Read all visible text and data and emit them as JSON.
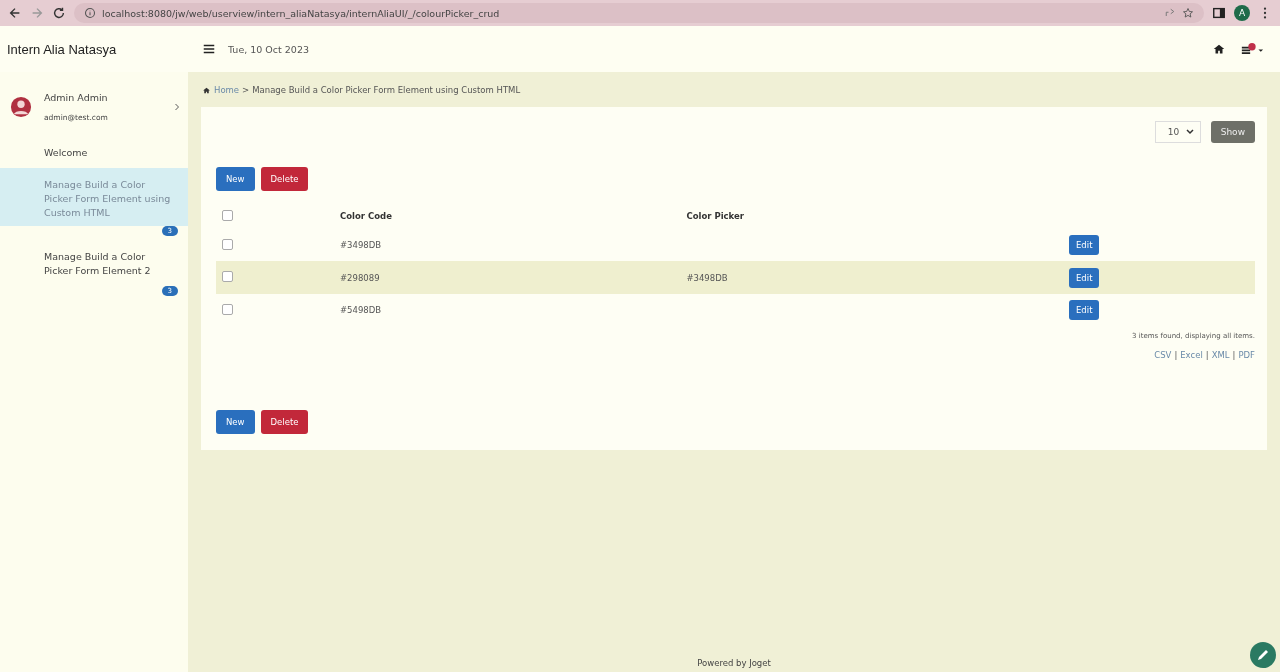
{
  "browser": {
    "url": "localhost:8080/jw/web/userview/intern_aliaNatasya/internAliaUI/_/colourPicker_crud",
    "avatar": "A"
  },
  "header": {
    "app_title": "Intern Alia Natasya",
    "date": "Tue, 10 Oct 2023"
  },
  "sidebar": {
    "user": {
      "name": "Admin Admin",
      "email": "admin@test.com"
    },
    "items": [
      {
        "label": "Welcome",
        "selected": false
      },
      {
        "label": "Manage Build a Color Picker Form Element using Custom HTML",
        "selected": true,
        "badge": "3"
      },
      {
        "label": "Manage Build a Color Picker Form Element 2",
        "selected": false,
        "badge": "3"
      }
    ]
  },
  "breadcrumb": {
    "home": "Home",
    "separator": ">",
    "current": "Manage Build a Color Picker Form Element using Custom HTML"
  },
  "page_size": {
    "value": "10",
    "button": "Show"
  },
  "top_actions": [
    {
      "kind": "primary",
      "label": "New"
    },
    {
      "kind": "danger",
      "label": "Delete"
    }
  ],
  "table": {
    "header_checked": false,
    "columns": [
      "Color Code",
      "Color Picker"
    ],
    "rows": [
      {
        "checked": false,
        "cells": [
          "#3498DB",
          ""
        ],
        "action": "Edit"
      },
      {
        "checked": false,
        "cells": [
          "#298089",
          "#3498DB"
        ],
        "action": "Edit"
      },
      {
        "checked": false,
        "cells": [
          "#5498DB",
          ""
        ],
        "action": "Edit"
      }
    ]
  },
  "summary": "3 items found, displaying all items.",
  "exports": [
    {
      "kind": "link",
      "text": "CSV"
    },
    {
      "kind": "separator",
      "text": "|"
    },
    {
      "kind": "link",
      "text": "Excel"
    },
    {
      "kind": "separator",
      "text": "|"
    },
    {
      "kind": "link",
      "text": "XML"
    },
    {
      "kind": "separator",
      "text": "|"
    },
    {
      "kind": "link",
      "text": "PDF"
    }
  ],
  "bottom_actions": [
    {
      "kind": "primary",
      "label": "New"
    },
    {
      "kind": "danger",
      "label": "Delete"
    }
  ],
  "footer": "Powered by Joget"
}
